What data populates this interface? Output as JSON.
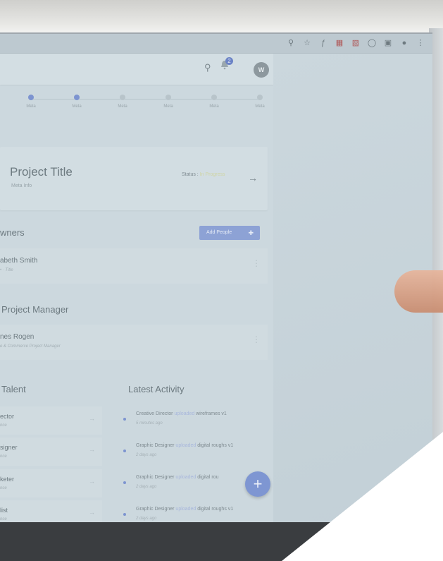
{
  "browser": {
    "toolbar_icons": [
      "search-icon",
      "star-icon",
      "script-icon",
      "ext-icon-1",
      "ext-icon-2",
      "ext-icon-3",
      "camera-icon",
      "ext-icon-4",
      "profile-icon",
      "menu-icon"
    ]
  },
  "header": {
    "notification_count": "2",
    "avatar_initial": "W"
  },
  "stepper": {
    "steps": [
      {
        "label": "Meta",
        "active": true
      },
      {
        "label": "Meta",
        "active": true
      },
      {
        "label": "Meta",
        "active": false
      },
      {
        "label": "Meta",
        "active": false
      },
      {
        "label": "Meta",
        "active": false
      },
      {
        "label": "Meta",
        "active": false
      }
    ]
  },
  "project": {
    "title": "Project Title",
    "meta": "Meta Info",
    "status_label": "Status :",
    "status_value": "In Progress"
  },
  "owners": {
    "title": "wners",
    "add_button": "Add People",
    "people": [
      {
        "name": "abeth Smith",
        "sub": "• · Title"
      }
    ]
  },
  "manager": {
    "title": "Project Manager",
    "people": [
      {
        "name": "nes Rogen",
        "sub": "e & Commerce Project Manager"
      }
    ]
  },
  "talent": {
    "title": "Talent",
    "items": [
      {
        "name": "ector",
        "sub": "nce"
      },
      {
        "name": "signer",
        "sub": "nce"
      },
      {
        "name": "keter",
        "sub": "nce"
      },
      {
        "name": "list",
        "sub": "nce"
      }
    ]
  },
  "activity": {
    "title": "Latest Activity",
    "items": [
      {
        "actor": "Creative Director",
        "verb": "uploaded",
        "object": "wireframes v1",
        "time": "5 minutes ago"
      },
      {
        "actor": "Graphic Designer",
        "verb": "uploaded",
        "object": "digital roughs v1",
        "time": "2 days ago"
      },
      {
        "actor": "Graphic Designer",
        "verb": "uploaded",
        "object": "digital rou",
        "time": "2 days ago"
      },
      {
        "actor": "Graphic Designer",
        "verb": "uploaded",
        "object": "digital roughs v1",
        "time": "2 days ago"
      }
    ]
  },
  "fab": {
    "label": "+"
  }
}
